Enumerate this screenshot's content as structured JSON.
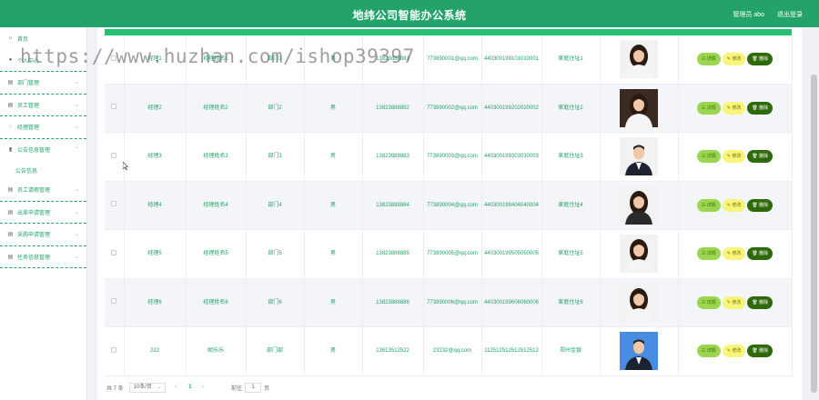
{
  "header": {
    "title": "地纬公司智能办公系统",
    "user": "管理员 abo",
    "logout": "退出登录"
  },
  "sidebar": {
    "items": [
      {
        "label": "首页",
        "icon": "home-icon",
        "has_chevron": false
      },
      {
        "label": "个人中心",
        "icon": "user-icon",
        "has_chevron": true
      },
      {
        "label": "部门管理",
        "icon": "list-icon",
        "has_chevron": true
      },
      {
        "label": "员工管理",
        "icon": "list-icon",
        "has_chevron": true
      },
      {
        "label": "经理管理",
        "icon": "bulb-icon",
        "has_chevron": true
      },
      {
        "label": "公告信息管理",
        "icon": "chart-icon",
        "has_chevron": true,
        "open": true
      },
      {
        "label": "公告信息",
        "icon": "",
        "sub": true
      },
      {
        "label": "员工请假管理",
        "icon": "list-icon",
        "has_chevron": true
      },
      {
        "label": "出差申请管理",
        "icon": "list-icon",
        "has_chevron": true
      },
      {
        "label": "采购申请管理",
        "icon": "list-icon",
        "has_chevron": true
      },
      {
        "label": "任务信息管理",
        "icon": "list-icon",
        "has_chevron": true
      }
    ]
  },
  "table": {
    "rows": [
      {
        "account": "经理1",
        "name": "经理姓名1",
        "dept": "部门1",
        "gender": "男",
        "phone": "13823888881",
        "email": "773890001@qq.com",
        "idcard": "440300199101010001",
        "address": "家庭住址1",
        "photo": "woman-1"
      },
      {
        "account": "经理2",
        "name": "经理姓名2",
        "dept": "部门2",
        "gender": "男",
        "phone": "13823888882",
        "email": "773890002@qq.com",
        "idcard": "440300199202020002",
        "address": "家庭住址2",
        "photo": "woman-2"
      },
      {
        "account": "经理3",
        "name": "经理姓名3",
        "dept": "部门3",
        "gender": "男",
        "phone": "13823888883",
        "email": "773890003@qq.com",
        "idcard": "440300199303030003",
        "address": "家庭住址3",
        "photo": "man-1"
      },
      {
        "account": "经理4",
        "name": "经理姓名4",
        "dept": "部门4",
        "gender": "男",
        "phone": "13823888884",
        "email": "773890004@qq.com",
        "idcard": "440300199404040004",
        "address": "家庭住址4",
        "photo": "woman-3"
      },
      {
        "account": "经理5",
        "name": "经理姓名5",
        "dept": "部门5",
        "gender": "男",
        "phone": "13823888885",
        "email": "773890005@qq.com",
        "idcard": "440300199505050005",
        "address": "家庭住址5",
        "photo": "woman-4"
      },
      {
        "account": "经理6",
        "name": "经理姓名6",
        "dept": "部门6",
        "gender": "男",
        "phone": "13823888886",
        "email": "773890006@qq.com",
        "idcard": "440300199606060006",
        "address": "家庭住址6",
        "photo": "woman-5"
      },
      {
        "account": "222",
        "name": "胡乐乐",
        "dept": "部门部",
        "gender": "男",
        "phone": "13613512522",
        "email": "23232@qq.com",
        "idcard": "112512512512512512",
        "address": "郑州金银",
        "photo": "man-2"
      }
    ],
    "actions": {
      "detail": "详情",
      "edit": "修改",
      "delete": "删除"
    }
  },
  "pager": {
    "total": "共 7 条",
    "page_size": "10条/页",
    "prev": "<",
    "current": "1",
    "next": ">",
    "goto_label": "前往",
    "goto_value": "1",
    "page_suffix": "页"
  },
  "watermark": "https://www.huzhan.com/ishop39397",
  "colors": {
    "brand": "#23a36a",
    "strip": "#23c273",
    "detail": "#9bd651",
    "edit": "#f7f57a",
    "delete": "#2f6a0a"
  }
}
